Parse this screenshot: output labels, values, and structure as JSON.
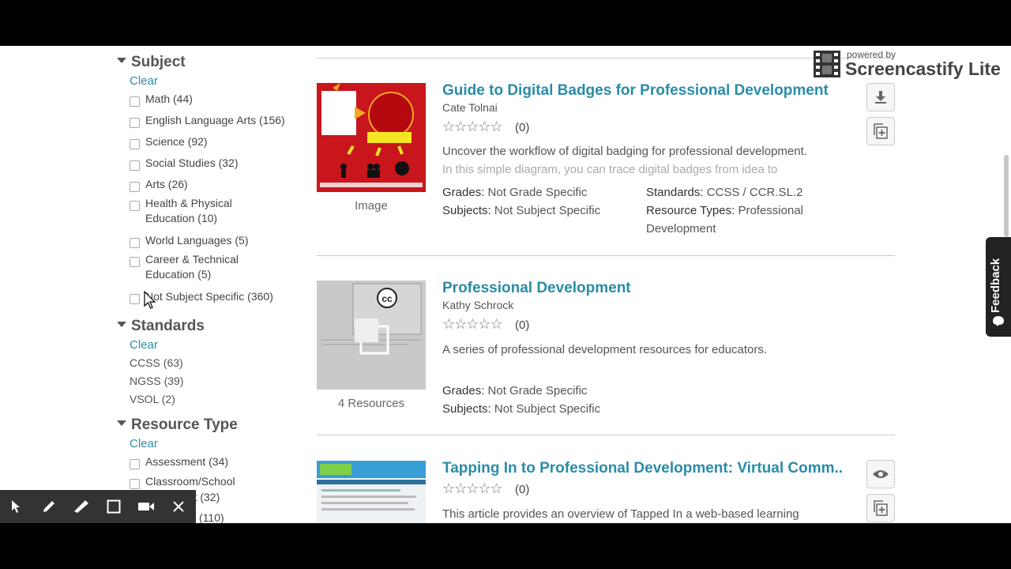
{
  "sidebar": {
    "subject": {
      "title": "Subject",
      "clear": "Clear",
      "options": [
        "Math (44)",
        "English Language Arts (156)",
        "Science (92)",
        "Social Studies (32)",
        "Arts (26)",
        "Health & Physical Education (10)",
        "World Languages (5)",
        "Career & Technical Education (5)",
        "Not Subject Specific (360)"
      ]
    },
    "standards": {
      "title": "Standards",
      "clear": "Clear",
      "options": [
        "CCSS (63)",
        "NGSS (39)",
        "VSOL (2)"
      ]
    },
    "resource_type": {
      "title": "Resource Type",
      "clear": "Clear",
      "options": [
        "Assessment (34)",
        "Classroom/School",
        "ent (32)",
        "(110)"
      ]
    }
  },
  "results": [
    {
      "title": "Guide to Digital Badges for Professional Development",
      "author": "Cate Tolnai",
      "rating": "(0)",
      "thumb_label": "Image",
      "desc_line1": "Uncover the workflow of digital badging for professional development.",
      "desc_line2": "In this simple diagram, you can trace digital badges from idea to",
      "grades_key": "Grades:",
      "grades_val": "Not Grade Specific",
      "subjects_key": "Subjects:",
      "subjects_val": "Not Subject Specific",
      "standards_key": "Standards:",
      "standards_val": "CCSS / CCR.SL.2",
      "types_key": "Resource Types:",
      "types_val1": "Professional",
      "types_val2": "Development"
    },
    {
      "title": "Professional Development",
      "author": "Kathy Schrock",
      "rating": "(0)",
      "thumb_label": "4 Resources",
      "desc_line1": "A series of professional development resources for educators.",
      "grades_key": "Grades:",
      "grades_val": "Not Grade Specific",
      "subjects_key": "Subjects:",
      "subjects_val": "Not Subject Specific"
    },
    {
      "title": "Tapping In to Professional Development: Virtual Comm..",
      "rating": "(0)",
      "desc_line1": "This article provides an overview of Tapped In  a web-based learning"
    }
  ],
  "watermark": {
    "small": "powered by",
    "big": "Screencastify Lite"
  },
  "feedback": {
    "label": "Feedback"
  },
  "stars": "☆☆☆☆☆",
  "colors": {
    "link": "#2a8ca8",
    "toolbar": "#333333"
  }
}
